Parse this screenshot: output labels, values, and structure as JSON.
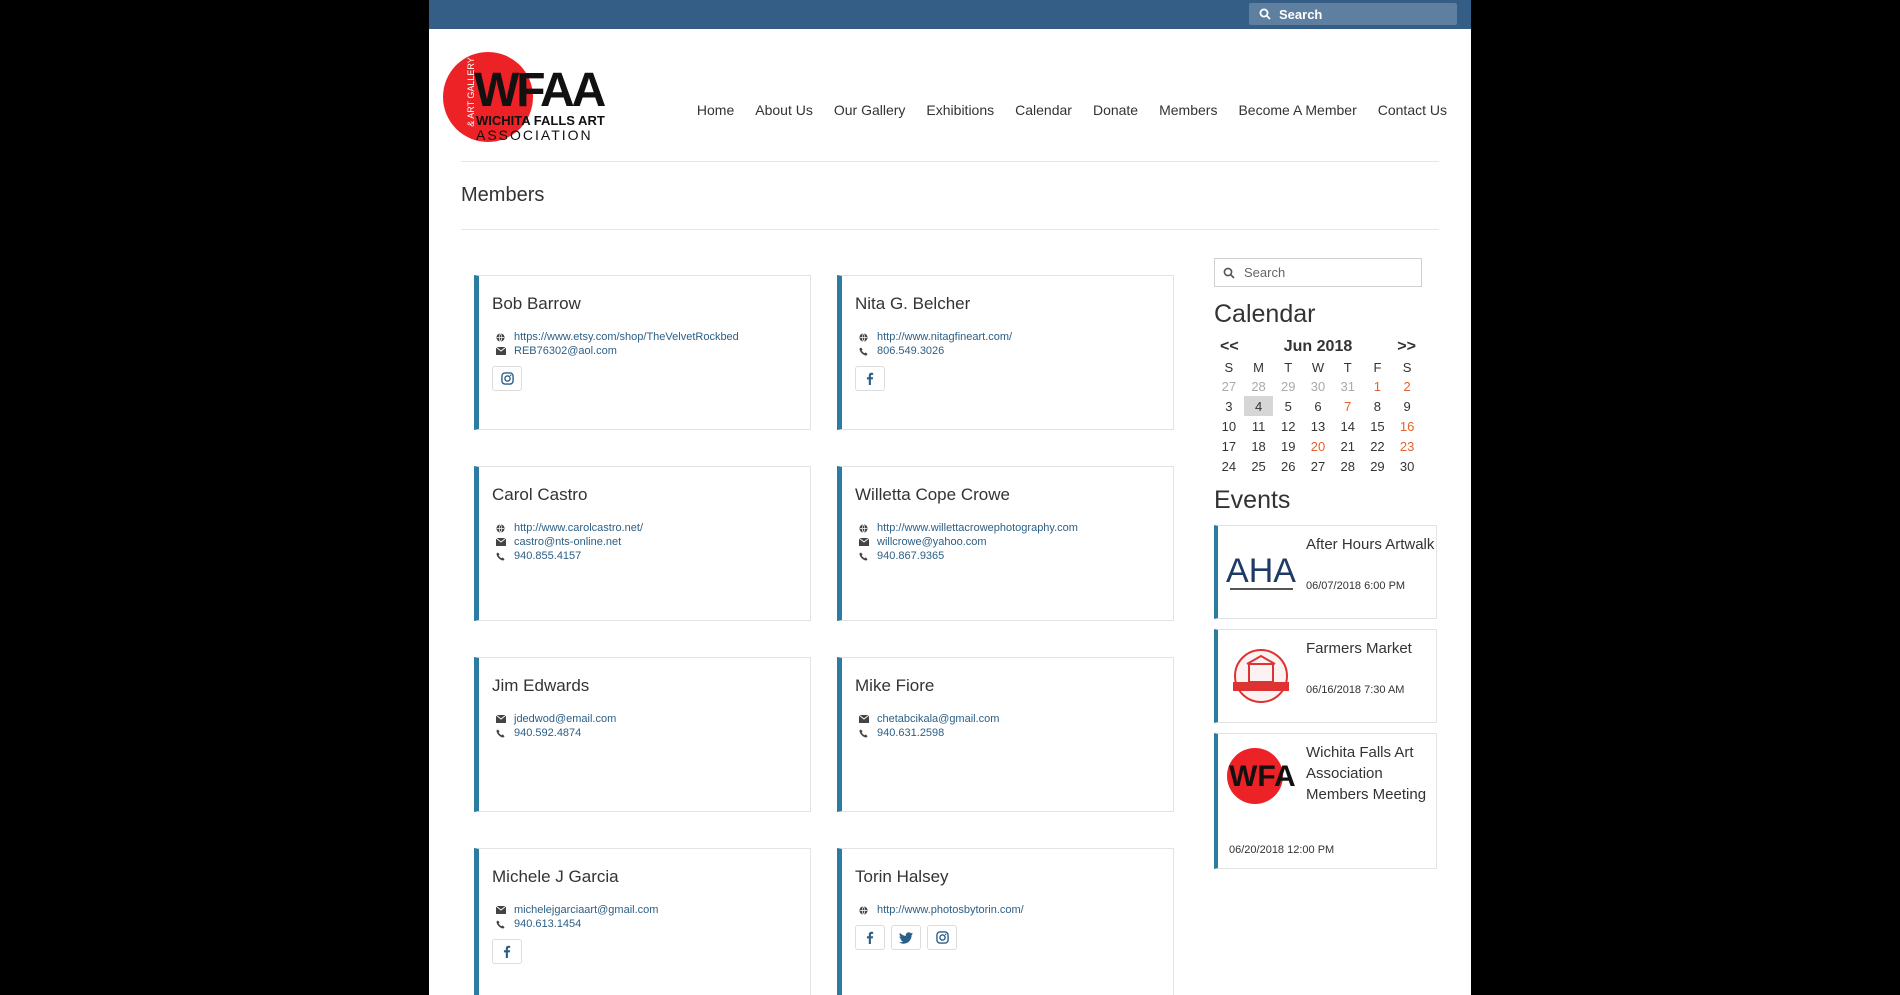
{
  "top_search": {
    "placeholder": "Search"
  },
  "logo": {
    "wordmark": "WFAA",
    "line1": "WICHITA FALLS ART",
    "line2": "ASSOCIATION",
    "vertical": "& ART GALLERY",
    "circle_color": "#ec2227"
  },
  "nav": {
    "items": [
      "Home",
      "About Us",
      "Our Gallery",
      "Exhibitions",
      "Calendar",
      "Donate",
      "Members",
      "Become A Member",
      "Contact Us"
    ]
  },
  "page": {
    "title": "Members"
  },
  "members": [
    {
      "name": "Bob Barrow",
      "lines": [
        {
          "icon": "globe-icon",
          "text": "https://www.etsy.com/shop/TheVelvetRockbed"
        },
        {
          "icon": "envelope-icon",
          "text": "REB76302@aol.com"
        }
      ],
      "socials": [
        "instagram-icon"
      ]
    },
    {
      "name": "Nita G. Belcher",
      "lines": [
        {
          "icon": "globe-icon",
          "text": "http://www.nitagfineart.com/"
        },
        {
          "icon": "phone-icon",
          "text": "806.549.3026"
        }
      ],
      "socials": [
        "facebook-icon"
      ]
    },
    {
      "name": "Carol Castro",
      "lines": [
        {
          "icon": "globe-icon",
          "text": "http://www.carolcastro.net/"
        },
        {
          "icon": "envelope-icon",
          "text": "castro@nts-online.net"
        },
        {
          "icon": "phone-icon",
          "text": "940.855.4157"
        }
      ],
      "socials": []
    },
    {
      "name": "Willetta Cope Crowe",
      "lines": [
        {
          "icon": "globe-icon",
          "text": "http://www.willettacrowephotography.com"
        },
        {
          "icon": "envelope-icon",
          "text": "willcrowe@yahoo.com"
        },
        {
          "icon": "phone-icon",
          "text": "940.867.9365"
        }
      ],
      "socials": []
    },
    {
      "name": "Jim Edwards",
      "lines": [
        {
          "icon": "envelope-icon",
          "text": "jdedwod@email.com"
        },
        {
          "icon": "phone-icon",
          "text": "940.592.4874"
        }
      ],
      "socials": []
    },
    {
      "name": "Mike Fiore",
      "lines": [
        {
          "icon": "envelope-icon",
          "text": "chetabcikala@gmail.com"
        },
        {
          "icon": "phone-icon",
          "text": "940.631.2598"
        }
      ],
      "socials": []
    },
    {
      "name": "Michele J Garcia",
      "lines": [
        {
          "icon": "envelope-icon",
          "text": "michelejgarciaart@gmail.com"
        },
        {
          "icon": "phone-icon",
          "text": "940.613.1454"
        }
      ],
      "socials": [
        "facebook-icon"
      ]
    },
    {
      "name": "Torin Halsey",
      "lines": [
        {
          "icon": "globe-icon",
          "text": "http://www.photosbytorin.com/"
        }
      ],
      "socials": [
        "facebook-icon",
        "twitter-icon",
        "instagram-icon"
      ]
    }
  ],
  "sidebar": {
    "search_placeholder": "Search",
    "calendar_title": "Calendar",
    "calendar": {
      "prev": "<<",
      "next": ">>",
      "month": "Jun 2018",
      "dows": [
        "S",
        "M",
        "T",
        "W",
        "T",
        "F",
        "S"
      ],
      "days": [
        {
          "d": "27",
          "s": "muted"
        },
        {
          "d": "28",
          "s": "muted"
        },
        {
          "d": "29",
          "s": "muted"
        },
        {
          "d": "30",
          "s": "muted"
        },
        {
          "d": "31",
          "s": "muted"
        },
        {
          "d": "1",
          "s": "orange"
        },
        {
          "d": "2",
          "s": "orange"
        },
        {
          "d": "3",
          "s": ""
        },
        {
          "d": "4",
          "s": "today"
        },
        {
          "d": "5",
          "s": ""
        },
        {
          "d": "6",
          "s": ""
        },
        {
          "d": "7",
          "s": "orange"
        },
        {
          "d": "8",
          "s": ""
        },
        {
          "d": "9",
          "s": ""
        },
        {
          "d": "10",
          "s": ""
        },
        {
          "d": "11",
          "s": ""
        },
        {
          "d": "12",
          "s": ""
        },
        {
          "d": "13",
          "s": ""
        },
        {
          "d": "14",
          "s": ""
        },
        {
          "d": "15",
          "s": ""
        },
        {
          "d": "16",
          "s": "orange"
        },
        {
          "d": "17",
          "s": ""
        },
        {
          "d": "18",
          "s": ""
        },
        {
          "d": "19",
          "s": ""
        },
        {
          "d": "20",
          "s": "orange"
        },
        {
          "d": "21",
          "s": ""
        },
        {
          "d": "22",
          "s": ""
        },
        {
          "d": "23",
          "s": "orange"
        },
        {
          "d": "24",
          "s": ""
        },
        {
          "d": "25",
          "s": ""
        },
        {
          "d": "26",
          "s": ""
        },
        {
          "d": "27",
          "s": ""
        },
        {
          "d": "28",
          "s": ""
        },
        {
          "d": "29",
          "s": ""
        },
        {
          "d": "30",
          "s": ""
        }
      ]
    },
    "events_title": "Events",
    "events": [
      {
        "name": "After Hours Artwalk",
        "date": "06/07/2018 6:00 PM",
        "thumb": "aha-logo"
      },
      {
        "name": "Farmers Market",
        "date": "06/16/2018 7:30 AM",
        "thumb": "farmers-market-logo"
      },
      {
        "name": "Wichita Falls Art Association Members Meeting",
        "date": "06/20/2018 12:00 PM",
        "thumb": "wfaa-logo"
      }
    ]
  }
}
